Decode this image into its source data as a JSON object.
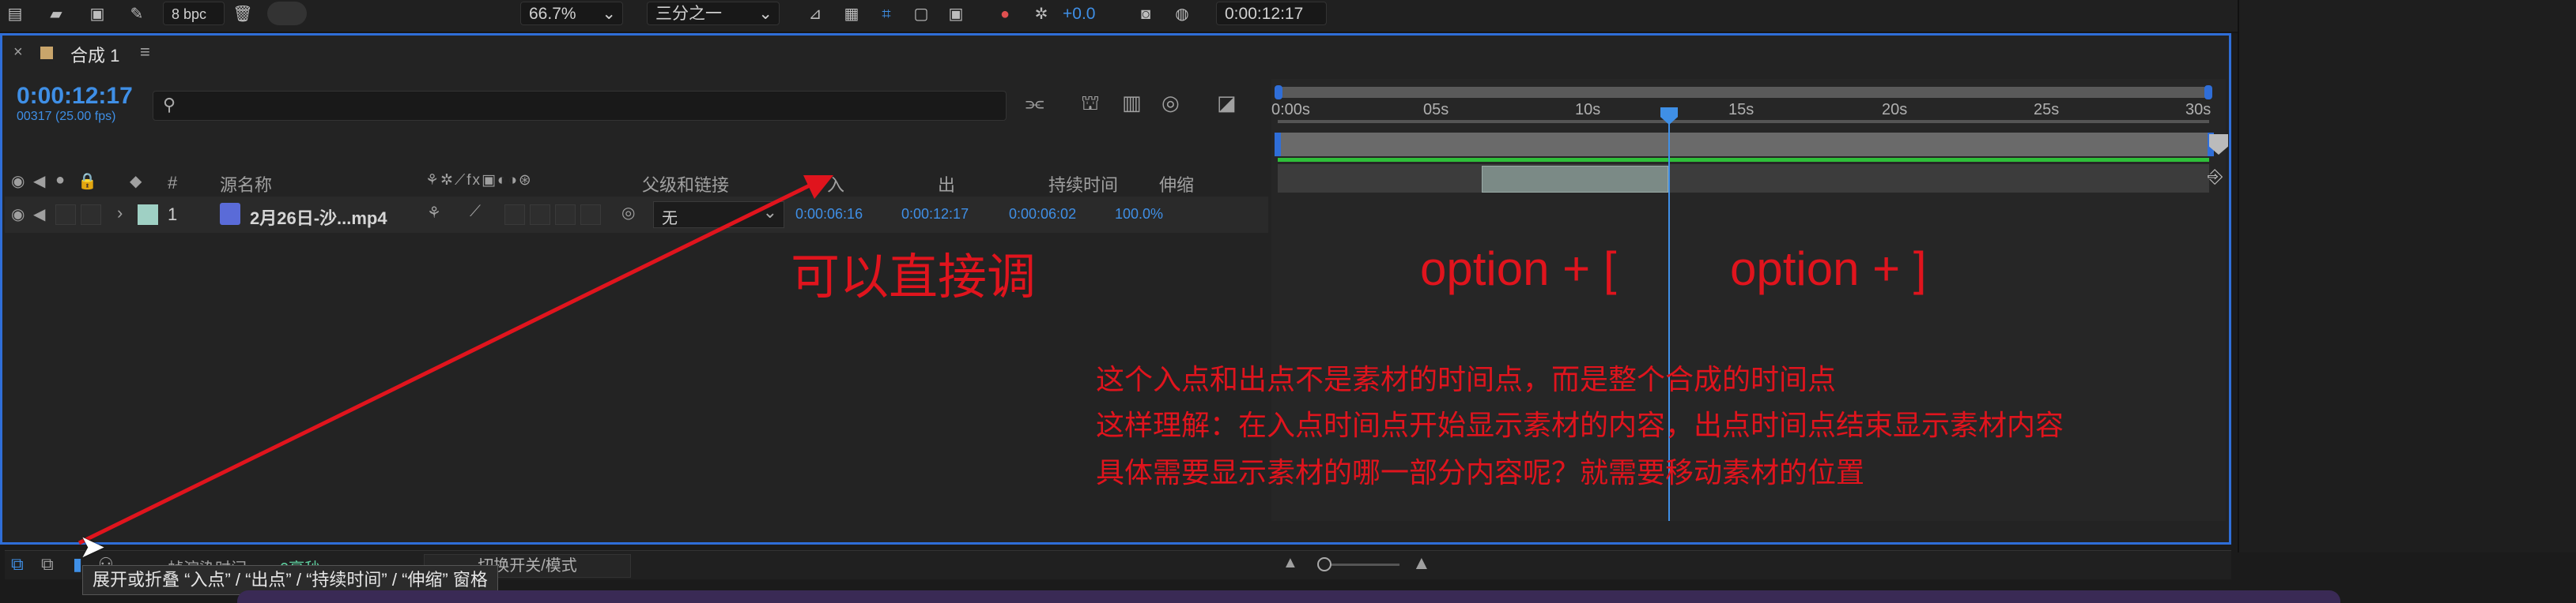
{
  "toolbar": {
    "bpc": "8 bpc",
    "zoom": "66.7%",
    "resolution": "三分之一",
    "exposure": "+0.0",
    "timecode": "0:00:12:17"
  },
  "comp": {
    "tab_title": "合成 1",
    "current_time": "0:00:12:17",
    "frame_info": "00317 (25.00 fps)",
    "search_placeholder": ""
  },
  "columns": {
    "number": "#",
    "source_name": "源名称",
    "parent_link": "父级和链接",
    "in": "入",
    "out": "出",
    "duration": "持续时间",
    "stretch": "伸缩"
  },
  "layer": {
    "index": "1",
    "name": "2月26日-沙...mp4",
    "parent": "无",
    "in": "0:00:06:16",
    "out": "0:00:12:17",
    "duration": "0:00:06:02",
    "stretch": "100.0%"
  },
  "timeline": {
    "ticks": [
      "0:00s",
      "05s",
      "10s",
      "15s",
      "20s",
      "25s",
      "30s"
    ]
  },
  "annotations": {
    "direct_adjust": "可以直接调",
    "shortcut_in": "option + [",
    "shortcut_out": "option + ]",
    "line1": "这个入点和出点不是素材的时间点，而是整个合成的时间点",
    "line2": "这样理解：在入点时间点开始显示素材的内容，出点时间点结束显示素材内容",
    "line3": "具体需要显示素材的哪一部分内容呢？就需要移动素材的位置"
  },
  "bottom": {
    "render_label": "帧渲染时间",
    "render_value": "0毫秒",
    "toggle_label": "切换开关/模式"
  },
  "tooltip": "展开或折叠 “入点” / “出点” / “持续时间” / “伸缩” 窗格",
  "colors": {
    "accent_blue": "#2f6ed8",
    "timecode_blue": "#3f8fe6",
    "annotation_red": "#e0141d",
    "work_area_green": "#2fbf3a",
    "label_teal": "#9fd0c4"
  }
}
